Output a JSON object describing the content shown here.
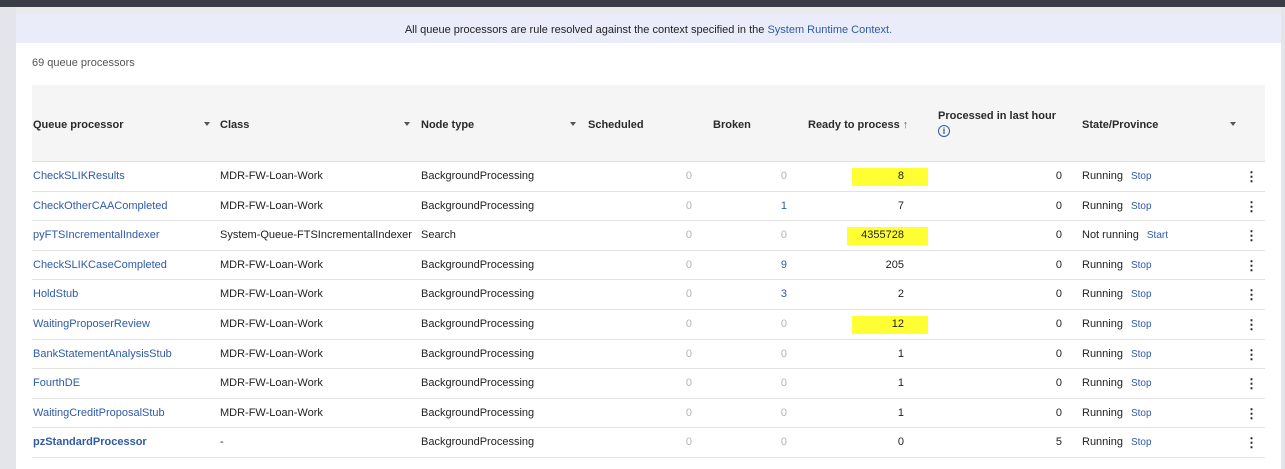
{
  "banner": {
    "text": "All queue processors are rule resolved against the context specified in the ",
    "link": "System Runtime Context."
  },
  "summary": {
    "count_text": "69 queue processors"
  },
  "columns": {
    "queue_processor": "Queue processor",
    "class": "Class",
    "node_type": "Node type",
    "scheduled": "Scheduled",
    "broken": "Broken",
    "ready": "Ready to process",
    "ready_sort_icon": "↑",
    "processed": "Processed in last hour",
    "state": "State/Province"
  },
  "icons": {
    "sort_ascending": "arrow-up-icon",
    "info": "info-circle-icon",
    "row_menu": "kebab-menu-icon",
    "column_filter": "caret-down-icon"
  },
  "colors": {
    "link": "#2f5aa8",
    "highlight": "#ffff33",
    "banner_bg": "#eaedf9"
  },
  "rows": [
    {
      "name": "CheckSLIKResults",
      "class": "MDR-FW-Loan-Work",
      "node": "BackgroundProcessing",
      "scheduled": "0",
      "broken": "0",
      "broken_link": false,
      "ready": "8",
      "highlight": true,
      "processed": "0",
      "state": "Running",
      "action": "Stop",
      "bold": false
    },
    {
      "name": "CheckOtherCAACompleted",
      "class": "MDR-FW-Loan-Work",
      "node": "BackgroundProcessing",
      "scheduled": "0",
      "broken": "1",
      "broken_link": true,
      "ready": "7",
      "highlight": false,
      "processed": "0",
      "state": "Running",
      "action": "Stop",
      "bold": false
    },
    {
      "name": "pyFTSIncrementalIndexer",
      "class": "System-Queue-FTSIncrementalIndexer",
      "node": "Search",
      "scheduled": "0",
      "broken": "0",
      "broken_link": false,
      "ready": "4355728",
      "highlight": true,
      "processed": "0",
      "state": "Not running",
      "action": "Start",
      "bold": false
    },
    {
      "name": "CheckSLIKCaseCompleted",
      "class": "MDR-FW-Loan-Work",
      "node": "BackgroundProcessing",
      "scheduled": "0",
      "broken": "9",
      "broken_link": true,
      "ready": "205",
      "highlight": false,
      "processed": "0",
      "state": "Running",
      "action": "Stop",
      "bold": false
    },
    {
      "name": "HoldStub",
      "class": "MDR-FW-Loan-Work",
      "node": "BackgroundProcessing",
      "scheduled": "0",
      "broken": "3",
      "broken_link": true,
      "ready": "2",
      "highlight": false,
      "processed": "0",
      "state": "Running",
      "action": "Stop",
      "bold": false
    },
    {
      "name": "WaitingProposerReview",
      "class": "MDR-FW-Loan-Work",
      "node": "BackgroundProcessing",
      "scheduled": "0",
      "broken": "0",
      "broken_link": false,
      "ready": "12",
      "highlight": true,
      "processed": "0",
      "state": "Running",
      "action": "Stop",
      "bold": false
    },
    {
      "name": "BankStatementAnalysisStub",
      "class": "MDR-FW-Loan-Work",
      "node": "BackgroundProcessing",
      "scheduled": "0",
      "broken": "0",
      "broken_link": false,
      "ready": "1",
      "highlight": false,
      "processed": "0",
      "state": "Running",
      "action": "Stop",
      "bold": false
    },
    {
      "name": "FourthDE",
      "class": "MDR-FW-Loan-Work",
      "node": "BackgroundProcessing",
      "scheduled": "0",
      "broken": "0",
      "broken_link": false,
      "ready": "1",
      "highlight": false,
      "processed": "0",
      "state": "Running",
      "action": "Stop",
      "bold": false
    },
    {
      "name": "WaitingCreditProposalStub",
      "class": "MDR-FW-Loan-Work",
      "node": "BackgroundProcessing",
      "scheduled": "0",
      "broken": "0",
      "broken_link": false,
      "ready": "1",
      "highlight": false,
      "processed": "0",
      "state": "Running",
      "action": "Stop",
      "bold": false
    },
    {
      "name": "pzStandardProcessor",
      "class": "-",
      "node": "BackgroundProcessing",
      "scheduled": "0",
      "broken": "0",
      "broken_link": false,
      "ready": "0",
      "highlight": false,
      "processed": "5",
      "state": "Running",
      "action": "Stop",
      "bold": true
    }
  ]
}
